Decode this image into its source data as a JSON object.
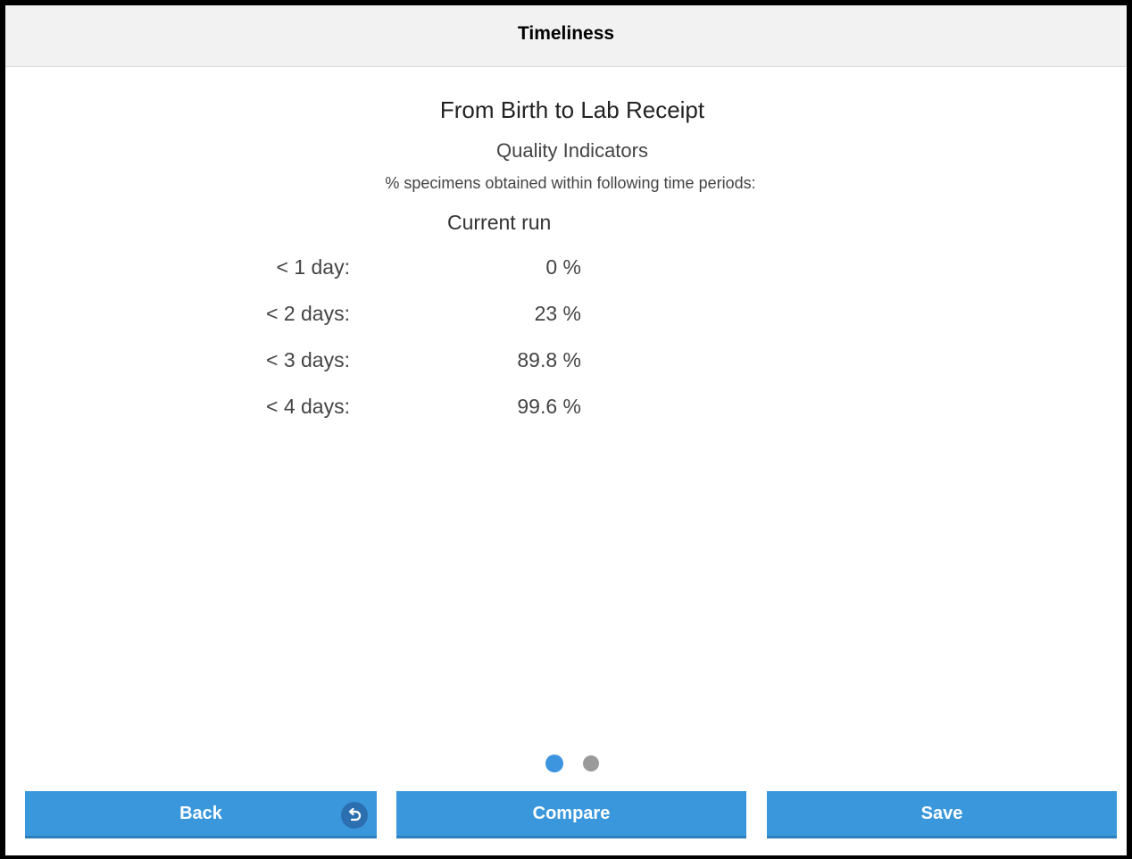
{
  "header": {
    "title": "Timeliness"
  },
  "main": {
    "section_title": "From Birth to Lab Receipt",
    "subtitle": "Quality Indicators",
    "description": "% specimens obtained within following time periods:",
    "column_header": "Current run",
    "rows": [
      {
        "label": "< 1 day:",
        "value": "0 %"
      },
      {
        "label": "< 2 days:",
        "value": "23 %"
      },
      {
        "label": "< 3 days:",
        "value": "89.8 %"
      },
      {
        "label": "< 4 days:",
        "value": "99.6 %"
      }
    ]
  },
  "pager": {
    "active_color": "#3d95e0",
    "inactive_color": "#9a9a9a"
  },
  "footer": {
    "back_label": "Back",
    "back_icon": "undo-icon",
    "compare_label": "Compare",
    "save_label": "Save",
    "button_color": "#3a97dc"
  }
}
